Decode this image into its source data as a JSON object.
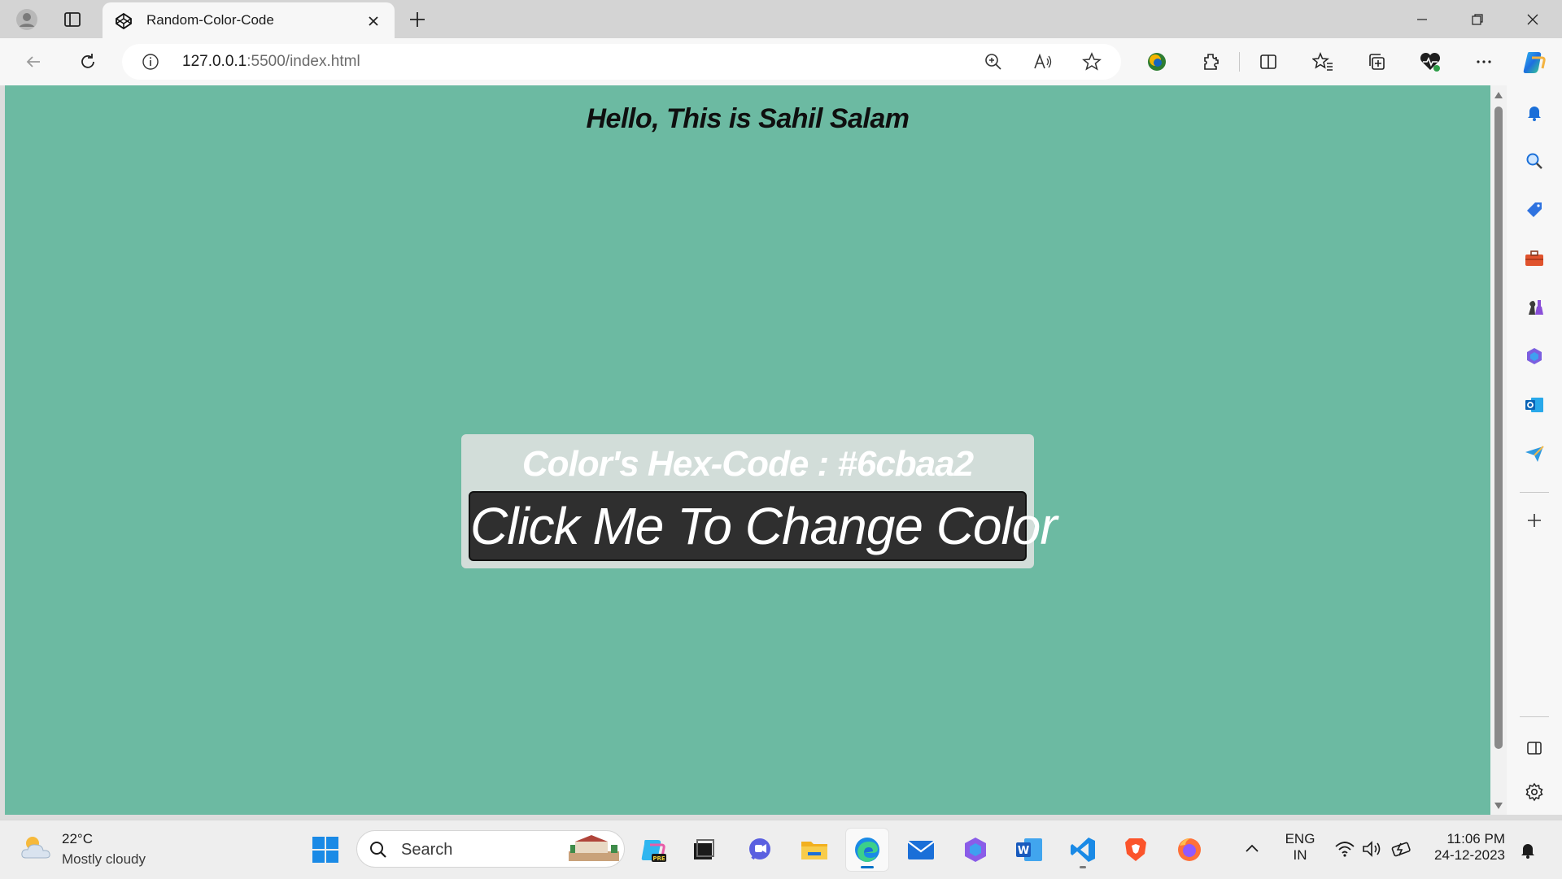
{
  "browser": {
    "tab": {
      "title": "Random-Color-Code"
    },
    "address": {
      "host": "127.0.0.1",
      "rest": ":5500/index.html"
    }
  },
  "page": {
    "heading": "Hello, This is Sahil Salam",
    "hex_label": "Color's Hex-Code : #6cbaa2",
    "button_label": "Click Me To Change Color",
    "background_color": "#6cbaa2"
  },
  "taskbar": {
    "weather": {
      "temp": "22°C",
      "desc": "Mostly cloudy"
    },
    "search_label": "Search",
    "language": {
      "lang": "ENG",
      "region": "IN"
    },
    "clock": {
      "time": "11:06 PM",
      "date": "24-12-2023"
    }
  },
  "colors": {
    "accent": "#0a73c8",
    "card": "#d2ddd9",
    "button": "#2f2f2f"
  }
}
